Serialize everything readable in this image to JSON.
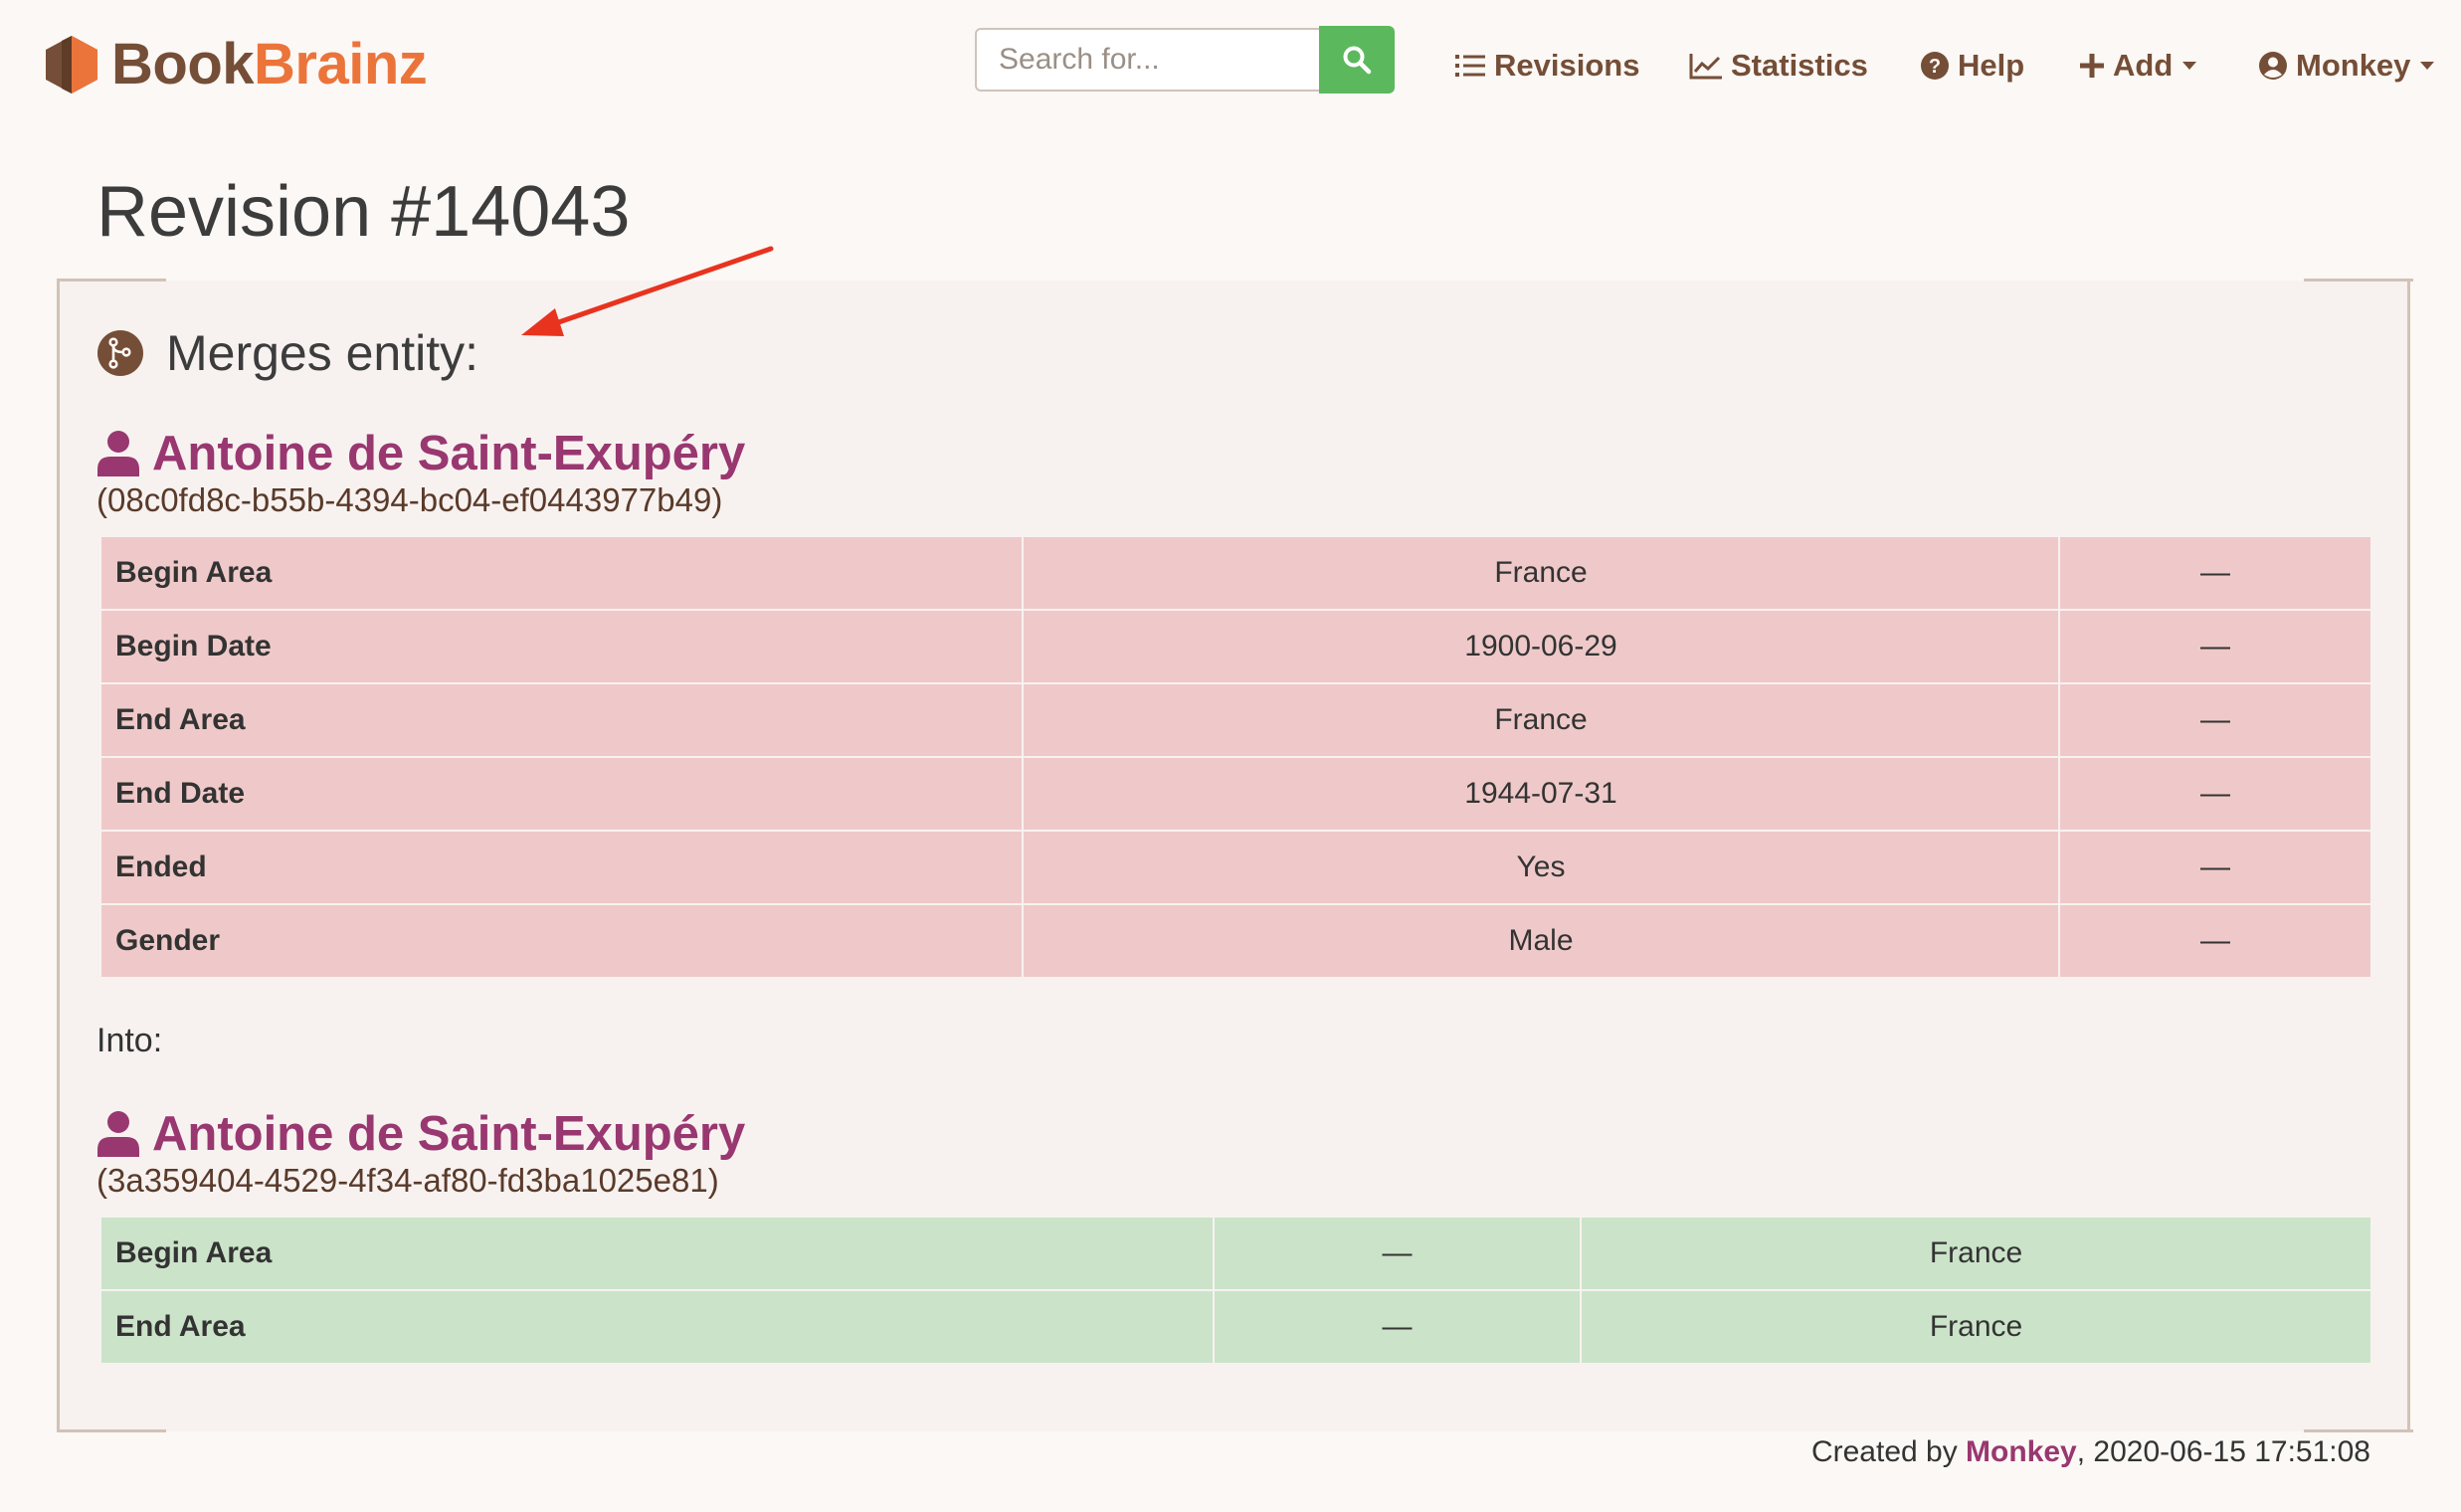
{
  "brand": {
    "part1": "Book",
    "part2": "Brainz"
  },
  "search": {
    "placeholder": "Search for..."
  },
  "nav": {
    "revisions": "Revisions",
    "statistics": "Statistics",
    "help": "Help",
    "add": "Add",
    "user": "Monkey"
  },
  "page": {
    "title": "Revision #14043"
  },
  "section": {
    "heading": "Merges entity:"
  },
  "source_entity": {
    "name": "Antoine de Saint-Exupéry",
    "id": "(08c0fd8c-b55b-4394-bc04-ef0443977b49)",
    "rows": [
      {
        "label": "Begin Area",
        "old": "France",
        "new": "—"
      },
      {
        "label": "Begin Date",
        "old": "1900-06-29",
        "new": "—"
      },
      {
        "label": "End Area",
        "old": "France",
        "new": "—"
      },
      {
        "label": "End Date",
        "old": "1944-07-31",
        "new": "—"
      },
      {
        "label": "Ended",
        "old": "Yes",
        "new": "—"
      },
      {
        "label": "Gender",
        "old": "Male",
        "new": "—"
      }
    ]
  },
  "into_label": "Into:",
  "target_entity": {
    "name": "Antoine de Saint-Exupéry",
    "id": "(3a359404-4529-4f34-af80-fd3ba1025e81)",
    "rows": [
      {
        "label": "Begin Area",
        "old": "—",
        "new": "France"
      },
      {
        "label": "End Area",
        "old": "—",
        "new": "France"
      }
    ]
  },
  "footer": {
    "prefix": "Created by ",
    "author": "Monkey",
    "suffix": ", 2020-06-15 17:51:08"
  },
  "colors": {
    "brand_brown": "#754e37",
    "brand_orange": "#eb743b",
    "entity_purple": "#993770",
    "deleted_row": "#efc9c9",
    "added_row": "#cbe3c9",
    "search_green": "#5cb85c",
    "annotation_arrow": "#e8331f"
  }
}
